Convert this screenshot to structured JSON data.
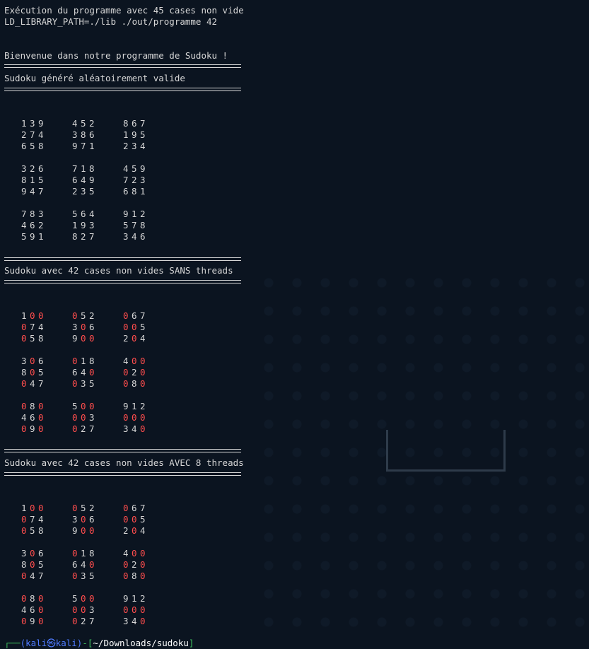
{
  "terminal": {
    "header_lines": [
      "Exécution du programme avec 45 cases non vide",
      "LD_LIBRARY_PATH=./lib ./out/programme 42"
    ],
    "welcome": "Bienvenue dans notre programme de Sudoku !",
    "section1_title": "Sudoku généré aléatoirement valide",
    "section2_title": "Sudoku avec 42 cases non vides SANS threads",
    "section3_title": "Sudoku avec 42 cases non vides AVEC 8 threads",
    "prompt": {
      "user": "(kali㉿kali)",
      "dash": "-[",
      "path": "~/Downloads/sudoku",
      "close": "]"
    }
  },
  "grids": {
    "generated": [
      [
        "1",
        "3",
        "9",
        "4",
        "5",
        "2",
        "8",
        "6",
        "7"
      ],
      [
        "2",
        "7",
        "4",
        "3",
        "8",
        "6",
        "1",
        "9",
        "5"
      ],
      [
        "6",
        "5",
        "8",
        "9",
        "7",
        "1",
        "2",
        "3",
        "4"
      ],
      [
        "3",
        "2",
        "6",
        "7",
        "1",
        "8",
        "4",
        "5",
        "9"
      ],
      [
        "8",
        "1",
        "5",
        "6",
        "4",
        "9",
        "7",
        "2",
        "3"
      ],
      [
        "9",
        "4",
        "7",
        "2",
        "3",
        "5",
        "6",
        "8",
        "1"
      ],
      [
        "7",
        "8",
        "3",
        "5",
        "6",
        "4",
        "9",
        "1",
        "2"
      ],
      [
        "4",
        "6",
        "2",
        "1",
        "9",
        "3",
        "5",
        "7",
        "8"
      ],
      [
        "5",
        "9",
        "1",
        "8",
        "2",
        "7",
        "3",
        "4",
        "6"
      ]
    ],
    "without_threads": [
      [
        "1",
        "0",
        "0",
        "0",
        "5",
        "2",
        "0",
        "6",
        "7"
      ],
      [
        "0",
        "7",
        "4",
        "3",
        "0",
        "6",
        "0",
        "0",
        "5"
      ],
      [
        "0",
        "5",
        "8",
        "9",
        "0",
        "0",
        "2",
        "0",
        "4"
      ],
      [
        "3",
        "0",
        "6",
        "0",
        "1",
        "8",
        "4",
        "0",
        "0"
      ],
      [
        "8",
        "0",
        "5",
        "6",
        "4",
        "0",
        "0",
        "2",
        "0"
      ],
      [
        "0",
        "4",
        "7",
        "0",
        "3",
        "5",
        "0",
        "8",
        "0"
      ],
      [
        "0",
        "8",
        "0",
        "5",
        "0",
        "0",
        "9",
        "1",
        "2"
      ],
      [
        "4",
        "6",
        "0",
        "0",
        "0",
        "3",
        "0",
        "0",
        "0"
      ],
      [
        "0",
        "9",
        "0",
        "0",
        "2",
        "7",
        "3",
        "4",
        "0"
      ]
    ],
    "with_threads": [
      [
        "1",
        "0",
        "0",
        "0",
        "5",
        "2",
        "0",
        "6",
        "7"
      ],
      [
        "0",
        "7",
        "4",
        "3",
        "0",
        "6",
        "0",
        "0",
        "5"
      ],
      [
        "0",
        "5",
        "8",
        "9",
        "0",
        "0",
        "2",
        "0",
        "4"
      ],
      [
        "3",
        "0",
        "6",
        "0",
        "1",
        "8",
        "4",
        "0",
        "0"
      ],
      [
        "8",
        "0",
        "5",
        "6",
        "4",
        "0",
        "0",
        "2",
        "0"
      ],
      [
        "0",
        "4",
        "7",
        "0",
        "3",
        "5",
        "0",
        "8",
        "0"
      ],
      [
        "0",
        "8",
        "0",
        "5",
        "0",
        "0",
        "9",
        "1",
        "2"
      ],
      [
        "4",
        "6",
        "0",
        "0",
        "0",
        "3",
        "0",
        "0",
        "0"
      ],
      [
        "0",
        "9",
        "0",
        "0",
        "2",
        "7",
        "3",
        "4",
        "0"
      ]
    ]
  },
  "colors": {
    "zero": "#ff4d4d",
    "text": "#d6d6d6",
    "background": "#0b1420",
    "prompt_user": "#4f7bff",
    "prompt_bracket": "#3fbf5f"
  }
}
